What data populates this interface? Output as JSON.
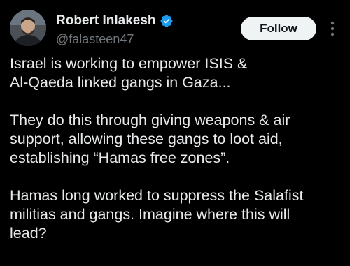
{
  "author": {
    "display_name": "Robert Inlakesh",
    "handle": "@falasteen47",
    "verified": true,
    "verified_color": "#1d9bf0"
  },
  "actions": {
    "follow_label": "Follow"
  },
  "icons": {
    "more": "more-vertical-icon",
    "verified": "verified-badge-icon"
  },
  "tweet": {
    "paragraphs": [
      "Israel is working to empower ISIS &\nAl-Qaeda linked gangs in Gaza...",
      "They do this through giving weapons & air\nsupport, allowing these gangs to loot aid,\nestablishing “Hamas free zones”.",
      "Hamas long worked to suppress the Salafist\nmilitias and gangs. Imagine where this will\nlead?"
    ]
  },
  "colors": {
    "background": "#000000",
    "text": "#e7e9ea",
    "secondary_text": "#71767b",
    "button_bg": "#eff3f4",
    "button_text": "#0f1419"
  }
}
